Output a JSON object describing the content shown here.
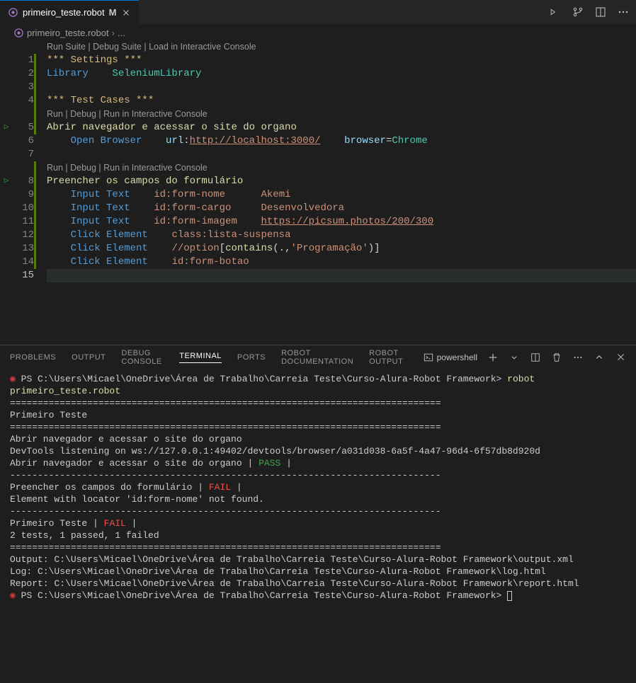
{
  "tab": {
    "filename": "primeiro_teste.robot",
    "modified_marker": "M"
  },
  "breadcrumb": {
    "filename": "primeiro_teste.robot",
    "rest": "..."
  },
  "editor": {
    "codelens_suite": "Run Suite | Debug Suite | Load in Interactive Console",
    "codelens_test": "Run | Debug | Run in Interactive Console",
    "lines": {
      "l1_settings": "*** Settings ***",
      "l2_library": "Library",
      "l2_value": "SeleniumLibrary",
      "l4_testcases": "*** Test Cases ***",
      "l5_tcname": "Abrir navegador e acessar o site do organo",
      "l6_kw": "Open Browser",
      "l6_urlkey": "url",
      "l6_urlval": "http://localhost:3000/",
      "l6_browserkey": "browser",
      "l6_browserval": "Chrome",
      "l8_tcname": "Preencher os campos do formulário",
      "l9_kw": "Input Text",
      "l9_loc": "id:form-nome",
      "l9_val": "Akemi",
      "l10_kw": "Input Text",
      "l10_loc": "id:form-cargo",
      "l10_val": "Desenvolvedora",
      "l11_kw": "Input Text",
      "l11_loc": "id:form-imagem",
      "l11_val": "https://picsum.photos/200/300",
      "l12_kw": "Click Element",
      "l12_loc": "class:lista-suspensa",
      "l13_kw": "Click Element",
      "l13_loc_a": "//option",
      "l13_loc_b": "[",
      "l13_loc_c": "contains",
      "l13_loc_d": "(.,",
      "l13_loc_e": "'Programação'",
      "l13_loc_f": ")",
      "l13_loc_g": "]",
      "l14_kw": "Click Element",
      "l14_loc": "id:form-botao"
    },
    "linenums": [
      "1",
      "2",
      "3",
      "4",
      "5",
      "6",
      "7",
      "8",
      "9",
      "10",
      "11",
      "12",
      "13",
      "14",
      "15"
    ]
  },
  "panel": {
    "tabs": {
      "problems": "PROBLEMS",
      "output": "OUTPUT",
      "debug": "DEBUG CONSOLE",
      "terminal": "TERMINAL",
      "ports": "PORTS",
      "robotdoc": "ROBOT DOCUMENTATION",
      "robotout": "ROBOT OUTPUT"
    },
    "shell": "powershell"
  },
  "terminal": {
    "prompt_path": "PS C:\\Users\\Micael\\OneDrive\\Área de Trabalho\\Carreia Teste\\Curso-Alura-Robot Framework>",
    "cmd": "robot primeiro_teste.robot",
    "sep_eq": "==============================================================================",
    "sep_dash": "------------------------------------------------------------------------------",
    "suite": "Primeiro Teste",
    "tc1": "Abrir navegador e acessar o site do organo",
    "devtools": "DevTools listening on ws://127.0.0.1:49402/devtools/browser/a031d038-6a5f-4a47-96d4-6f57db8d920d",
    "tc1_result_line": "Abrir navegador e acessar o site do organo                            ",
    "pass": "PASS",
    "tc2": "Preencher os campos do formulário                                     ",
    "fail": "FAIL",
    "tc2_err": "Element with locator 'id:form-nome' not found.",
    "suite_result": "Primeiro Teste                                                        ",
    "summary": "2 tests, 1 passed, 1 failed",
    "out_label": "Output:  ",
    "out_path": "C:\\Users\\Micael\\OneDrive\\Área de Trabalho\\Carreia Teste\\Curso-Alura-Robot Framework\\output.xml",
    "log_label": "Log:     ",
    "log_path": "C:\\Users\\Micael\\OneDrive\\Área de Trabalho\\Carreia Teste\\Curso-Alura-Robot Framework\\log.html",
    "rep_label": "Report:  ",
    "rep_path": "C:\\Users\\Micael\\OneDrive\\Área de Trabalho\\Carreia Teste\\Curso-Alura-Robot Framework\\report.html"
  }
}
